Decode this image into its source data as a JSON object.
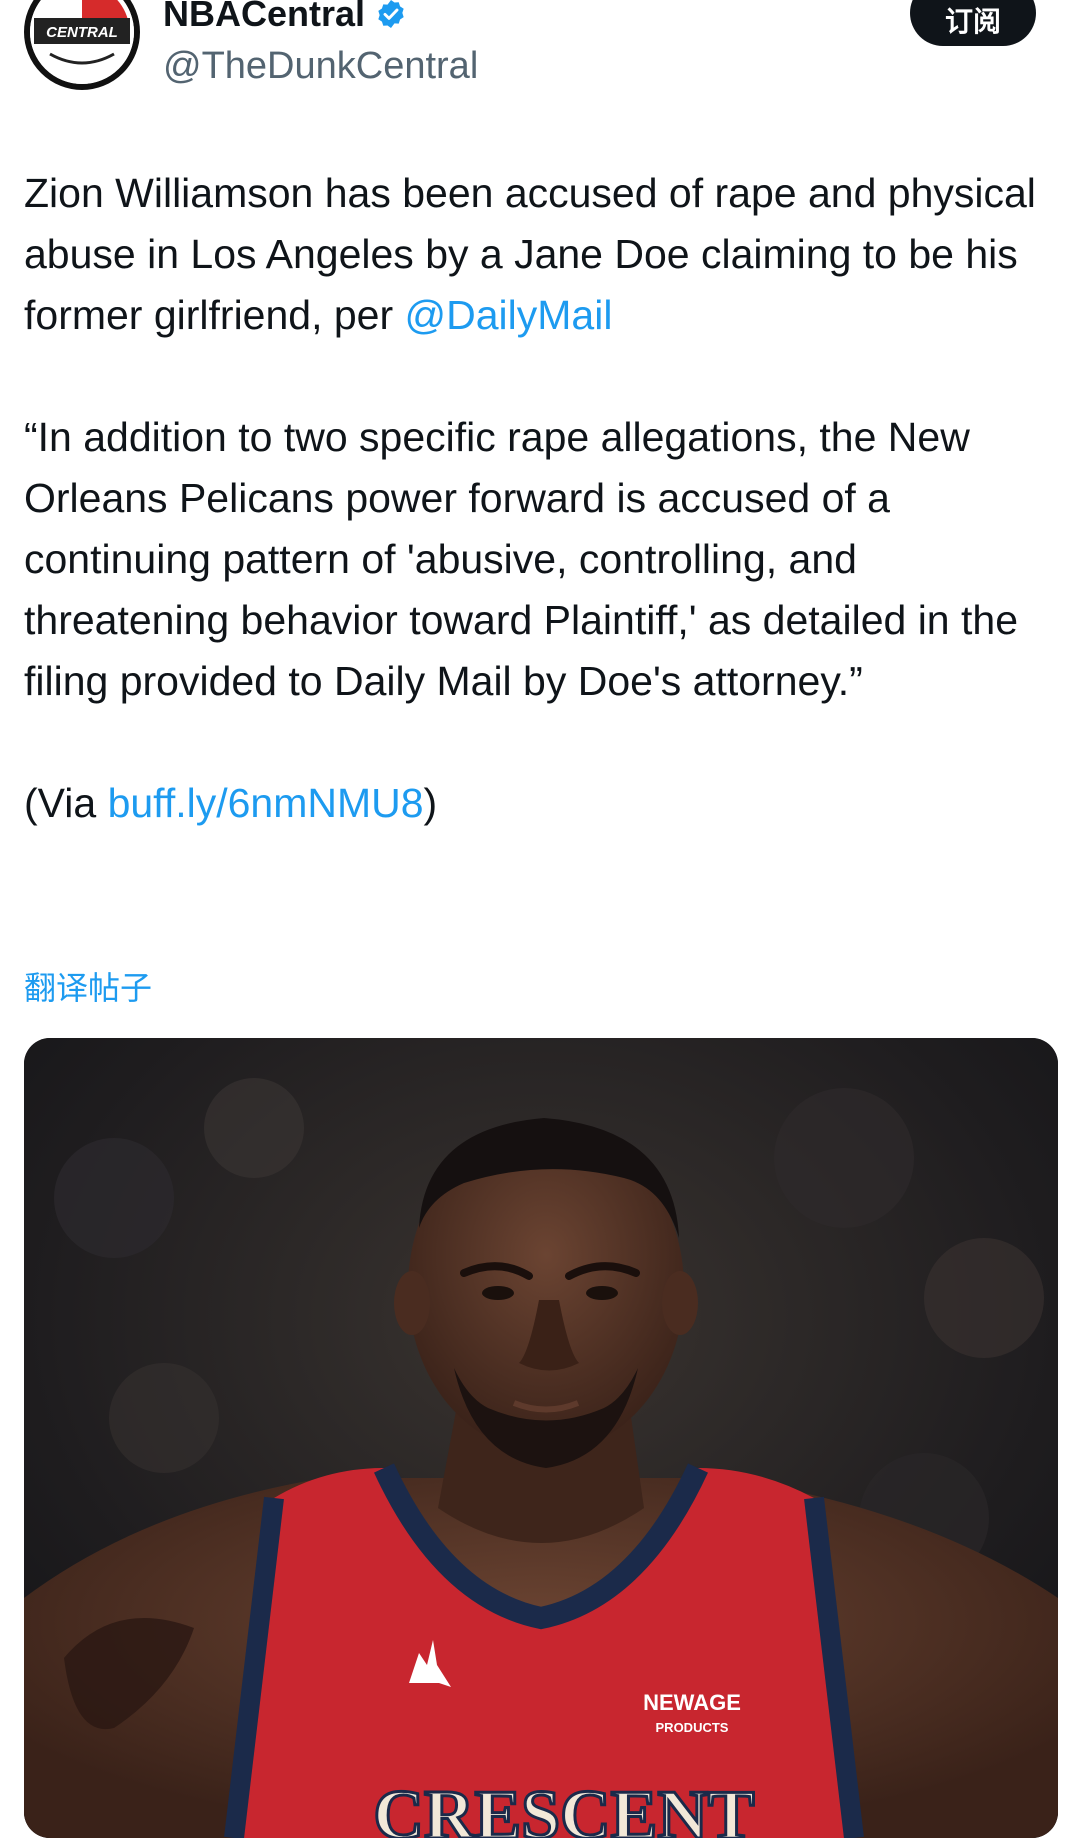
{
  "header": {
    "display_name": "NBACentral",
    "handle": "@TheDunkCentral",
    "subscribe_label": "订阅",
    "avatar_text": "CENTRAL",
    "verified_icon": "verified-badge-icon",
    "accent_color": "#1d9bf0"
  },
  "tweet": {
    "p1_text": "Zion Williamson has been accused of rape and physical abuse in Los Angeles by a Jane Doe claiming to be his former girlfriend, per ",
    "p1_mention": "@DailyMail",
    "p2_text": "“In addition to two specific rape allegations, the New Orleans Pelicans power forward is accused of a continuing pattern of 'abusive, controlling, and threatening behavior toward Plaintiff,' as detailed in the filing provided to Daily Mail by Doe's attorney.”",
    "p3_prefix": "(Via ",
    "p3_link": "buff.ly/6nmNMU8",
    "p3_suffix": ")"
  },
  "translate_label": "翻译帖子",
  "media": {
    "jersey_sponsor_line1": "NEWAGE",
    "jersey_sponsor_line2": "PRODUCTS",
    "jersey_text": "CRESCENT"
  }
}
